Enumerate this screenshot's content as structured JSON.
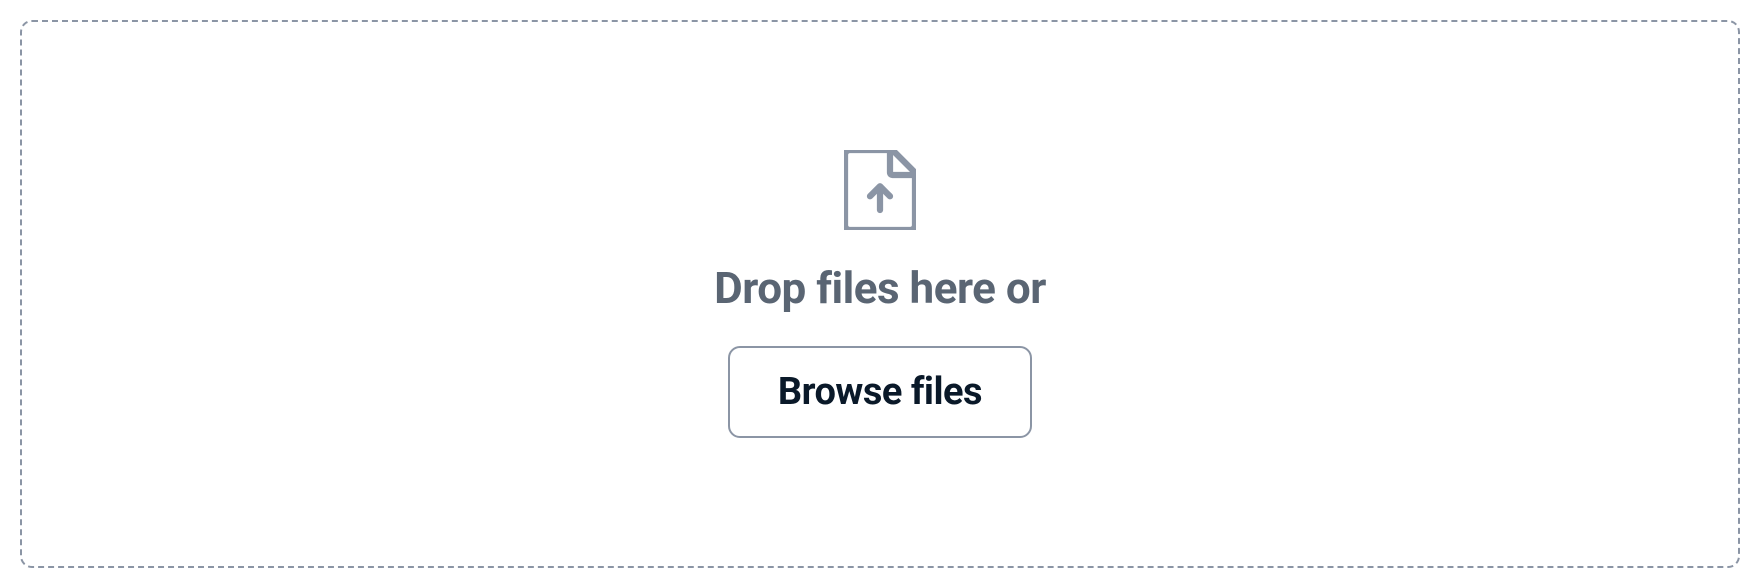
{
  "dropzone": {
    "prompt_text": "Drop files here or",
    "browse_button_label": "Browse files"
  }
}
